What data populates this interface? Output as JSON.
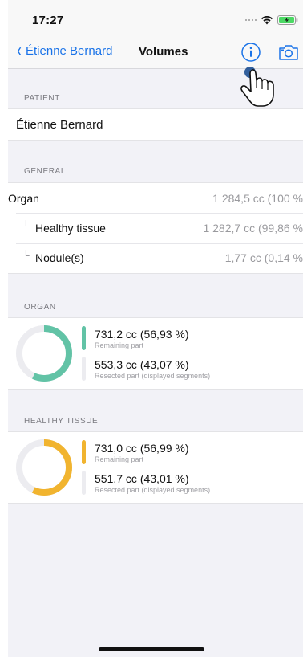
{
  "status_bar": {
    "time": "17:27"
  },
  "nav": {
    "back_label": "Étienne Bernard",
    "title": "Volumes"
  },
  "patient": {
    "section_title": "PATIENT",
    "name": "Étienne Bernard"
  },
  "general": {
    "section_title": "GENERAL",
    "rows": [
      {
        "label": "Organ",
        "value": "1 284,5 cc (100 %"
      },
      {
        "label": "Healthy tissue",
        "value": "1 282,7 cc (99,86 %"
      },
      {
        "label": "Nodule(s)",
        "value": "1,77 cc (0,14 %"
      }
    ]
  },
  "organ": {
    "section_title": "ORGAN",
    "color": "#62c3a6",
    "remaining_fraction": 0.5693,
    "remaining_value": "731,2 cc (56,93 %)",
    "remaining_caption": "Remaining part",
    "resected_value": "553,3 cc (43,07 %)",
    "resected_caption": "Resected part (displayed segments)"
  },
  "healthy_tissue": {
    "section_title": "HEALTHY TISSUE",
    "color": "#f1b42f",
    "remaining_fraction": 0.5699,
    "remaining_value": "731,0 cc (56,99 %)",
    "remaining_caption": "Remaining part",
    "resected_value": "551,7 cc (43,01 %)",
    "resected_caption": "Resected part (displayed segments)"
  },
  "icons": {
    "back": "chevron-left-icon",
    "info": "info-circle-icon",
    "camera": "camera-icon",
    "cursor": "hand-pointer-icon"
  },
  "colors": {
    "accent": "#1a73e8",
    "track": "#ececf0"
  }
}
